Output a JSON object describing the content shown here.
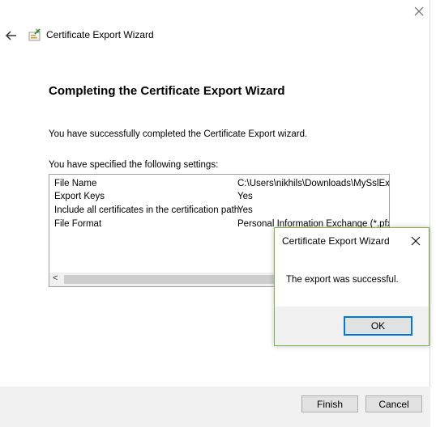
{
  "wizard": {
    "title": "Certificate Export Wizard",
    "heading": "Completing the Certificate Export Wizard",
    "success_text": "You have successfully completed the Certificate Export wizard.",
    "specified_text": "You have specified the following settings:",
    "settings": [
      {
        "label": "File Name",
        "value": "C:\\Users\\nikhils\\Downloads\\MySslExpo"
      },
      {
        "label": "Export Keys",
        "value": "Yes"
      },
      {
        "label": "Include all certificates in the certification path",
        "value": "Yes"
      },
      {
        "label": "File Format",
        "value": "Personal Information Exchange (*.pfx)"
      }
    ],
    "scroll_left_glyph": "<",
    "buttons": {
      "finish": "Finish",
      "cancel": "Cancel"
    }
  },
  "dialog": {
    "title": "Certificate Export Wizard",
    "message": "The export was successful.",
    "ok_label": "OK"
  },
  "icons": {
    "close": "close-icon",
    "back": "back-arrow-icon",
    "wizard": "certificate-wizard-icon"
  },
  "colors": {
    "accent": "#0078d7",
    "dialog_border": "#7eb14c",
    "footer_bg": "#f0f0f0"
  }
}
